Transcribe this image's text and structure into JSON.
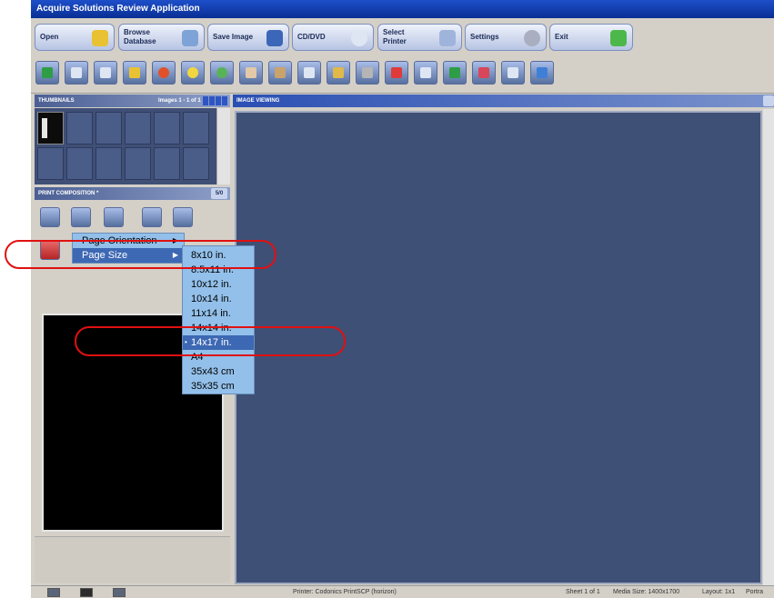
{
  "app": {
    "title": "Acquire Solutions Review Application"
  },
  "main_toolbar": [
    {
      "label": "Open",
      "icon": "folder-icon",
      "color": "#e8c232"
    },
    {
      "label": "Browse\nDatabase",
      "icon": "database-icon",
      "color": "#7ea3d6"
    },
    {
      "label": "Save Image",
      "icon": "disk-icon",
      "color": "#3c66b8"
    },
    {
      "label": "CD/DVD",
      "icon": "cd-icon",
      "color": "#dfe6f3"
    },
    {
      "label": "Select\nPrinter",
      "icon": "printer-icon",
      "color": "#9fb4db"
    },
    {
      "label": "Settings",
      "icon": "gear-icon",
      "color": "#a9aec0"
    },
    {
      "label": "Exit",
      "icon": "exit-arrow-icon",
      "color": "#4db84a"
    }
  ],
  "icon_toolbar": [
    {
      "icon": "layout-icon",
      "color": "#2e9d46"
    },
    {
      "icon": "grid-icon",
      "color": "#dfe6f3"
    },
    {
      "icon": "grid4-icon",
      "color": "#dfe6f3"
    },
    {
      "icon": "chart-icon",
      "color": "#e8c232"
    },
    {
      "icon": "rotate-icon",
      "color": "#e0512a"
    },
    {
      "icon": "brightness-icon",
      "color": "#f2d640"
    },
    {
      "icon": "zoom-icon",
      "color": "#58b357"
    },
    {
      "icon": "hand-icon",
      "color": "#e3c9a8"
    },
    {
      "icon": "person-icon",
      "color": "#c9a36b"
    },
    {
      "icon": "monitor-icon",
      "color": "#dfe6f3"
    },
    {
      "icon": "measure-icon",
      "color": "#e0b94a"
    },
    {
      "icon": "ruler-icon",
      "color": "#b5b5b5"
    },
    {
      "icon": "angle-icon",
      "color": "#e03a3a"
    },
    {
      "icon": "text-icon",
      "color": "#dfe6f3"
    },
    {
      "icon": "flip-icon",
      "color": "#2e9d46"
    },
    {
      "icon": "invert-icon",
      "color": "#d8465a"
    },
    {
      "icon": "crop-icon",
      "color": "#dfe6f3"
    },
    {
      "icon": "undo-icon",
      "color": "#3f7fd6"
    }
  ],
  "thumbnails": {
    "title": "THUMBNAILS",
    "count": "Images 1 - 1 of 1"
  },
  "print_composition": {
    "title": "PRINT COMPOSITION *",
    "button": "5/0"
  },
  "image_viewing": {
    "title": "IMAGE VIEWING"
  },
  "context_menu": {
    "items": [
      {
        "label": "Page Orientation"
      },
      {
        "label": "Page Size"
      }
    ]
  },
  "page_size_menu": {
    "options": [
      "8x10 in.",
      "8.5x11 in.",
      "10x12 in.",
      "10x14 in.",
      "11x14 in.",
      "14x14 in.",
      "14x17 in.",
      "A4",
      "35x43 cm",
      "35x35 cm"
    ],
    "selected": "14x17 in."
  },
  "status_bar": {
    "printer": "Printer: Codonics PrintSCP (horizon)",
    "sheet": "Sheet 1 of 1",
    "media_size": "Media Size: 1400x1700",
    "layout": "Layout: 1x1",
    "orientation": "Portra"
  }
}
